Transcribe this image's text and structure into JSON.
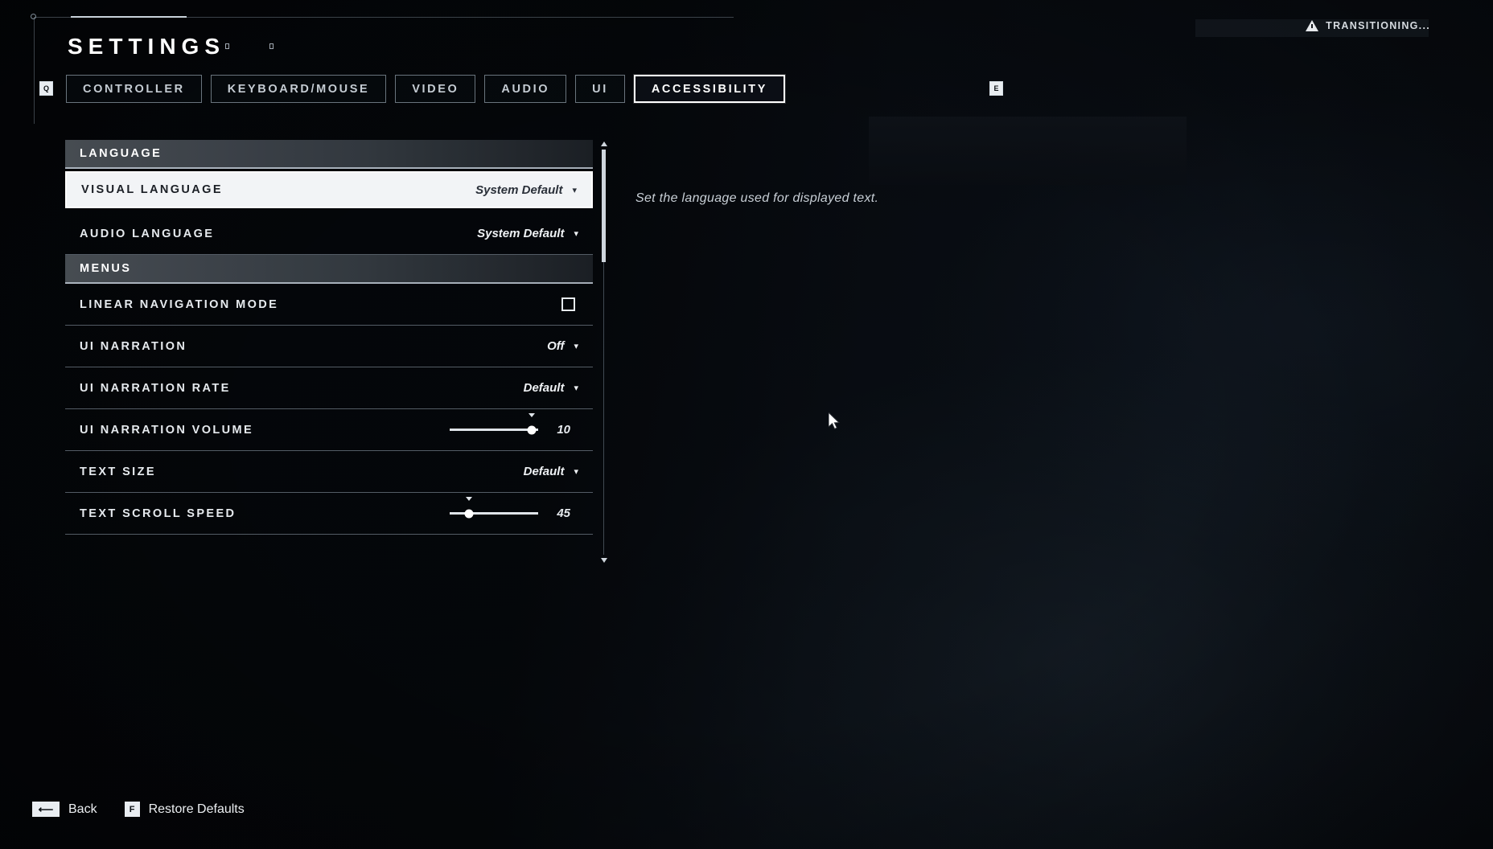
{
  "header": {
    "title": "SETTINGS",
    "status_text": "TRANSITIONING...",
    "status_icon": "warning-triangle-icon",
    "key_hint_left": "Q",
    "key_hint_right": "E"
  },
  "tabs": [
    {
      "label": "CONTROLLER",
      "selected": false
    },
    {
      "label": "KEYBOARD/MOUSE",
      "selected": false
    },
    {
      "label": "VIDEO",
      "selected": false
    },
    {
      "label": "AUDIO",
      "selected": false
    },
    {
      "label": "UI",
      "selected": false
    },
    {
      "label": "ACCESSIBILITY",
      "selected": true
    }
  ],
  "sections": [
    {
      "title": "LANGUAGE",
      "rows": [
        {
          "label": "VISUAL LANGUAGE",
          "type": "dropdown",
          "value": "System Default",
          "caret": "▾",
          "highlighted": true
        },
        {
          "label": "AUDIO LANGUAGE",
          "type": "dropdown",
          "value": "System Default",
          "caret": "▾",
          "highlighted": false
        }
      ]
    },
    {
      "title": "MENUS",
      "rows": [
        {
          "label": "LINEAR NAVIGATION MODE",
          "type": "checkbox",
          "checked": false,
          "highlighted": false
        },
        {
          "label": "UI NARRATION",
          "type": "dropdown",
          "value": "Off",
          "caret": "▾",
          "highlighted": false
        },
        {
          "label": "UI NARRATION RATE",
          "type": "dropdown",
          "value": "Default",
          "caret": "▾",
          "highlighted": false
        },
        {
          "label": "UI NARRATION VOLUME",
          "type": "slider",
          "value": "10",
          "percent": 93,
          "highlighted": false
        },
        {
          "label": "TEXT SIZE",
          "type": "dropdown",
          "value": "Default",
          "caret": "▾",
          "highlighted": false
        },
        {
          "label": "TEXT SCROLL SPEED",
          "type": "slider",
          "value": "45",
          "percent": 22,
          "highlighted": false
        }
      ]
    }
  ],
  "description": "Set the language used for displayed text.",
  "footer": {
    "back_key": "⟵",
    "back_label": "Back",
    "restore_key": "F",
    "restore_label": "Restore Defaults"
  },
  "colors": {
    "accent": "#ffffff",
    "panel_bg": "#05080c",
    "row_border": "#96a3b0",
    "highlight_bg": "#f2f4f6"
  }
}
